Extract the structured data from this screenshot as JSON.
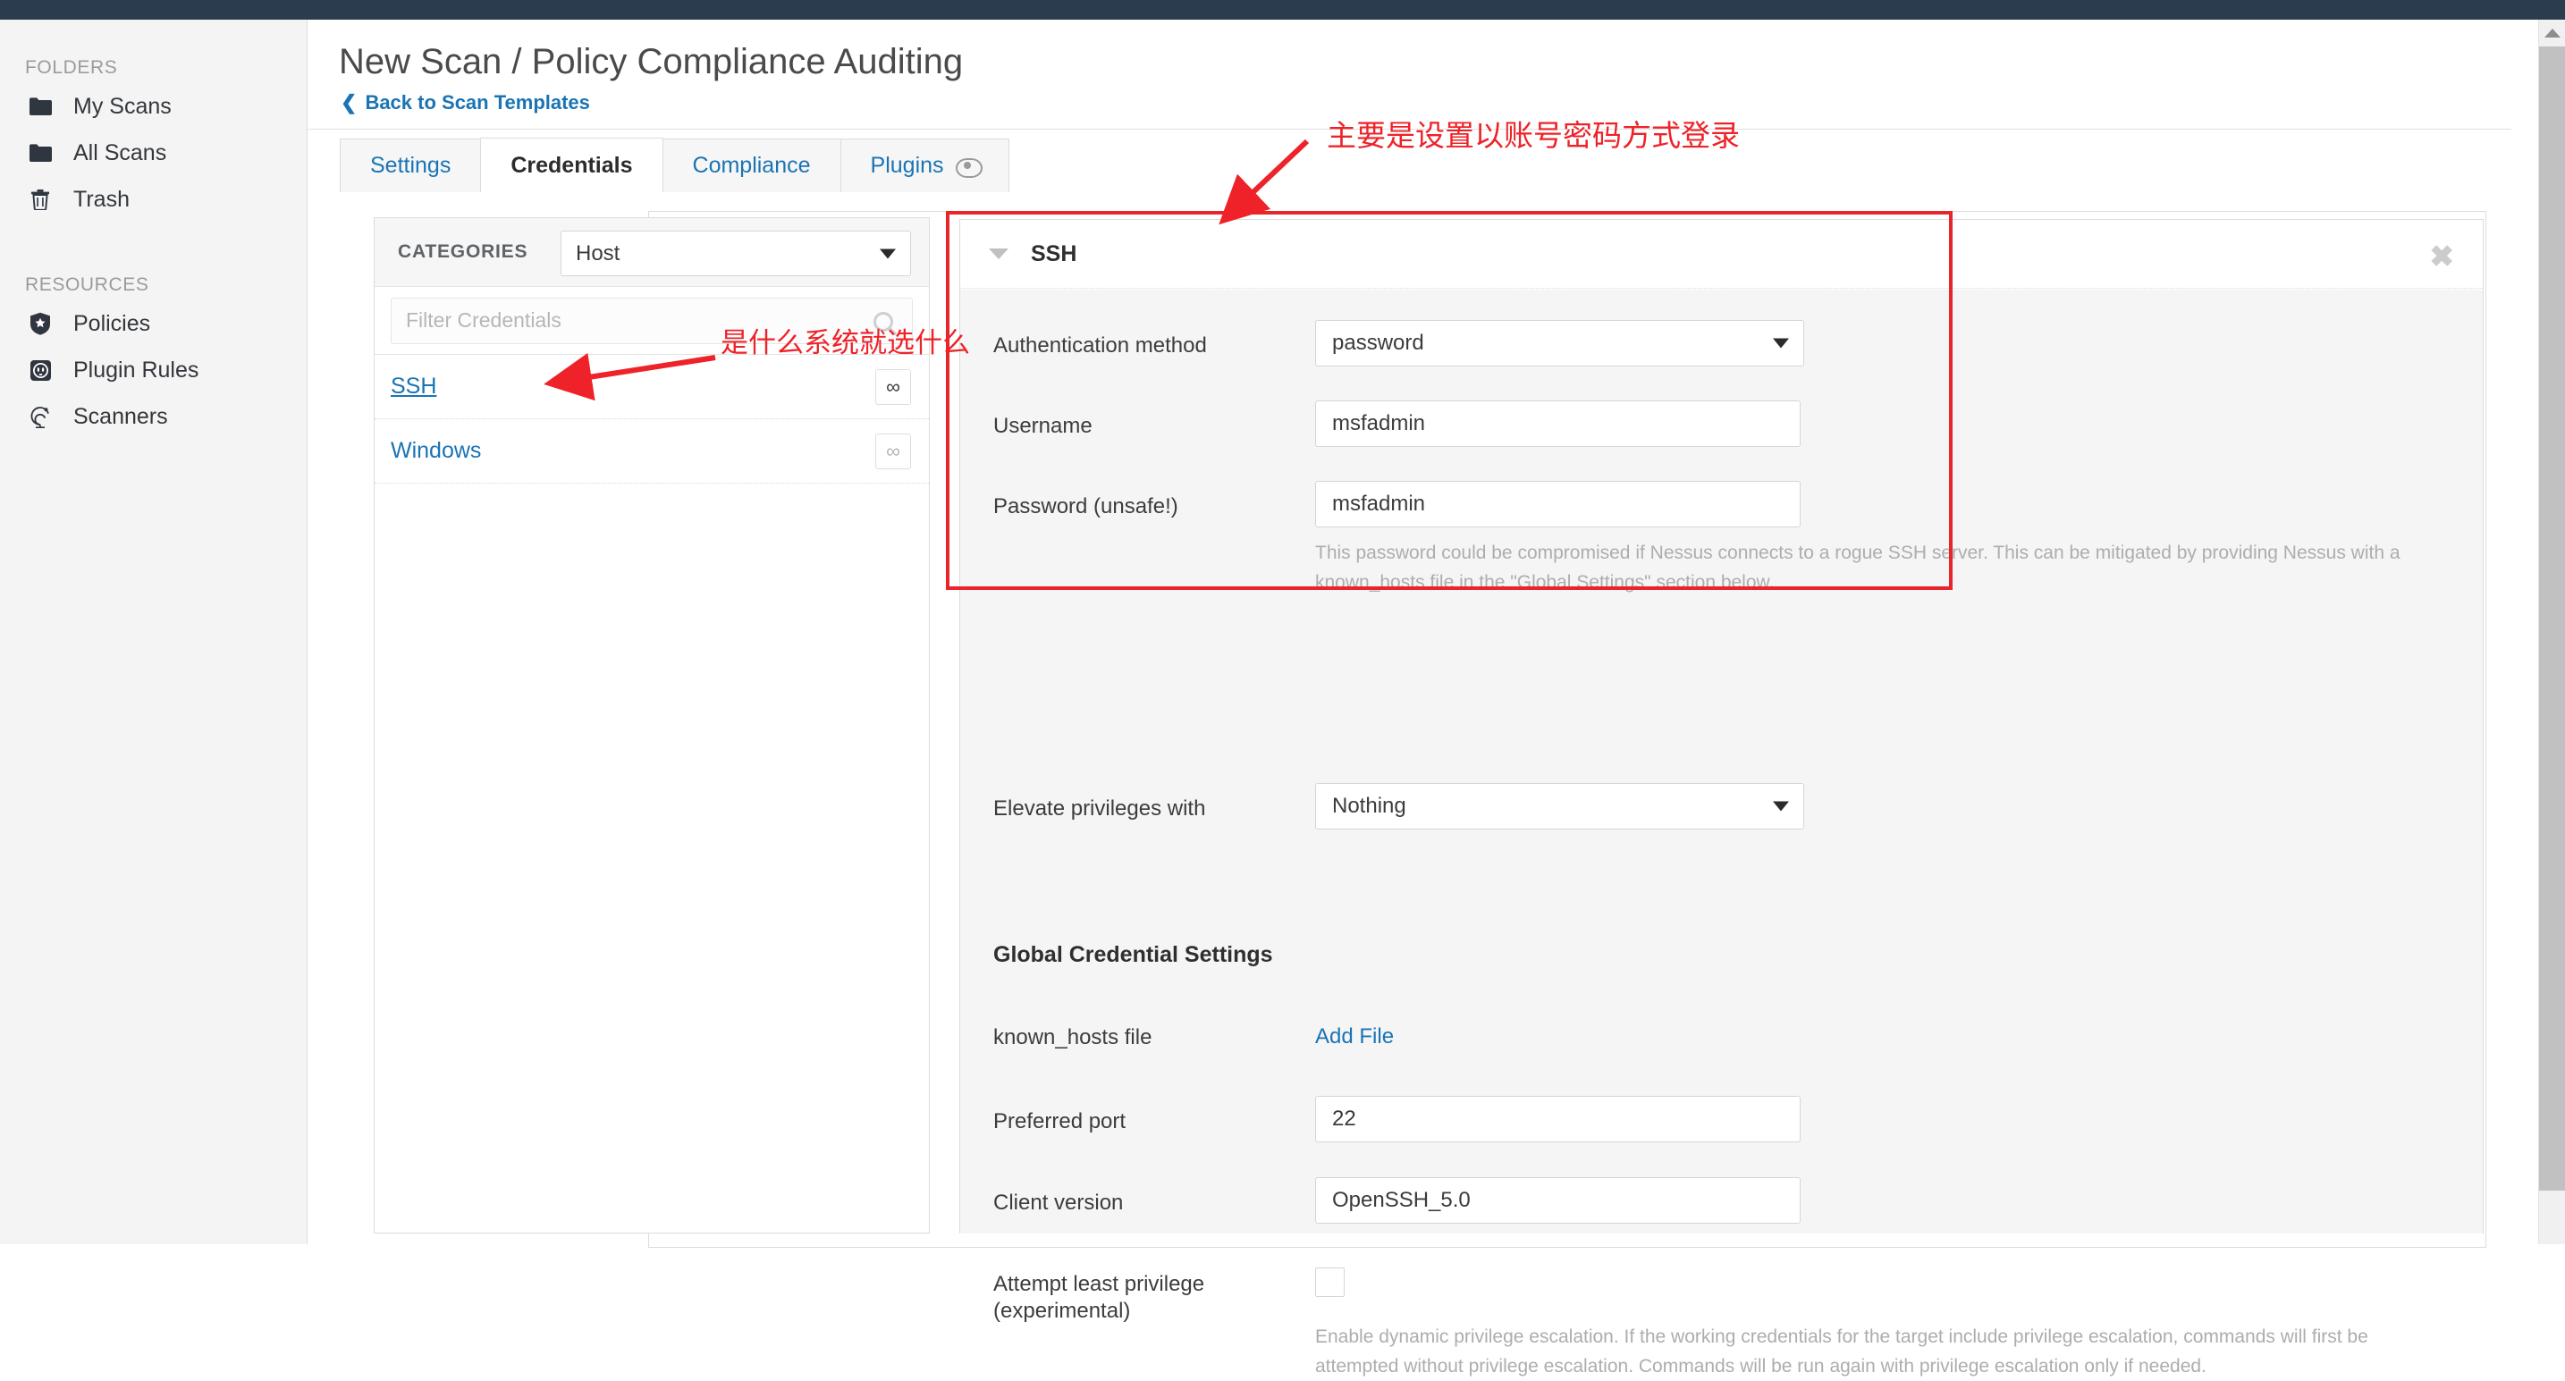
{
  "sidebar": {
    "groups": [
      {
        "title": "FOLDERS",
        "items": [
          {
            "label": "My Scans",
            "icon": "folder-icon"
          },
          {
            "label": "All Scans",
            "icon": "folder-icon"
          },
          {
            "label": "Trash",
            "icon": "trash-icon"
          }
        ]
      },
      {
        "title": "RESOURCES",
        "items": [
          {
            "label": "Policies",
            "icon": "shield-star-icon"
          },
          {
            "label": "Plugin Rules",
            "icon": "outlet-icon"
          },
          {
            "label": "Scanners",
            "icon": "radar-icon"
          }
        ]
      }
    ]
  },
  "header": {
    "title": "New Scan / Policy Compliance Auditing",
    "back_link": "Back to Scan Templates",
    "back_chevron": "❮"
  },
  "tabs": [
    {
      "label": "Settings",
      "active": false,
      "icon": null
    },
    {
      "label": "Credentials",
      "active": true,
      "icon": null
    },
    {
      "label": "Compliance",
      "active": false,
      "icon": null
    },
    {
      "label": "Plugins",
      "active": false,
      "icon": "eye-icon"
    }
  ],
  "categories": {
    "label": "CATEGORIES",
    "selected": "Host",
    "filter_placeholder": "Filter Credentials",
    "filter_value": "",
    "items": [
      {
        "name": "SSH",
        "badge": "∞",
        "selected": true
      },
      {
        "name": "Windows",
        "badge": "∞",
        "selected": false
      }
    ]
  },
  "detail": {
    "title": "SSH",
    "close_label": "✖",
    "fields": [
      {
        "label": "Authentication method",
        "value": "password",
        "type": "select"
      },
      {
        "label": "Username",
        "value": "msfadmin",
        "type": "text"
      },
      {
        "label": "Password (unsafe!)",
        "value": "msfadmin",
        "type": "text"
      }
    ],
    "password_helper": "This password could be compromised if Nessus connects to a rogue SSH server. This can be mitigated by providing Nessus with a known_hosts file in the \"Global Settings\" section below.",
    "elevate": {
      "label": "Elevate privileges with",
      "value": "Nothing"
    },
    "global_settings_title": "Global Credential Settings",
    "known_hosts": {
      "label": "known_hosts file",
      "action": "Add File"
    },
    "preferred_port": {
      "label": "Preferred port",
      "value": "22"
    },
    "client_version": {
      "label": "Client version",
      "value": "OpenSSH_5.0"
    },
    "least_privilege": {
      "label": "Attempt least privilege (experimental)",
      "checked": false,
      "helper": "Enable dynamic privilege escalation. If the working credentials for the target include privilege escalation, commands will first be attempted without privilege escalation. Commands will be run again with privilege escalation only if needed."
    }
  },
  "annotations": {
    "color": "#ee2228",
    "note_top": "主要是设置以账号密码方式登录",
    "note_left": "是什么系统就选什么"
  },
  "colors": {
    "topbar": "#2b3c4e",
    "link": "#1a74b4",
    "annotation_red": "#ee2228"
  }
}
